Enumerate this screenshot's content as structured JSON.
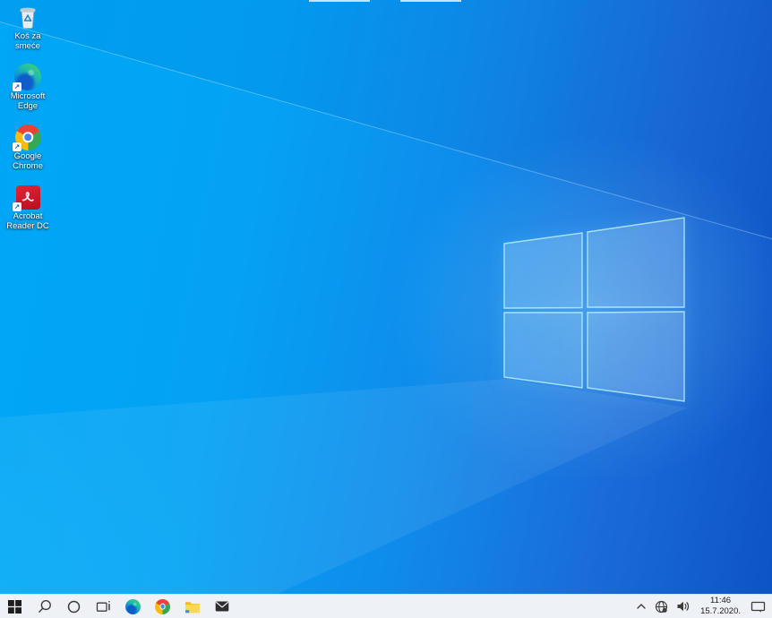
{
  "desktop": {
    "icons": [
      {
        "name": "recycle-bin",
        "label": "Koš za smeće",
        "shortcut": false
      },
      {
        "name": "microsoft-edge",
        "label": "Microsoft Edge",
        "shortcut": true
      },
      {
        "name": "google-chrome",
        "label": "Google Chrome",
        "shortcut": true
      },
      {
        "name": "acrobat-reader",
        "label": "Acrobat Reader DC",
        "shortcut": true
      }
    ],
    "shortcut_arrow": "↗"
  },
  "taskbar": {
    "buttons": [
      {
        "name": "start",
        "icon": "windows-logo-icon"
      },
      {
        "name": "search",
        "icon": "search-icon"
      },
      {
        "name": "cortana",
        "icon": "cortana-circle-icon"
      },
      {
        "name": "task-view",
        "icon": "task-view-icon"
      },
      {
        "name": "microsoft-edge",
        "icon": "edge-icon"
      },
      {
        "name": "google-chrome",
        "icon": "chrome-icon"
      },
      {
        "name": "file-explorer",
        "icon": "folder-icon"
      },
      {
        "name": "mail",
        "icon": "mail-icon"
      }
    ],
    "tray": {
      "hidden_icons": {
        "icon": "chevron-up-icon"
      },
      "network": {
        "icon": "globe-network-icon"
      },
      "volume": {
        "icon": "speaker-icon"
      },
      "clock": {
        "time": "11:46",
        "date": "15.7.2020."
      },
      "action_center": {
        "icon": "action-center-icon"
      }
    }
  },
  "colors": {
    "wallpaper_left": "#00a7f6",
    "wallpaper_right": "#0d53c6",
    "logo_stroke": "#b9f0ff",
    "taskbar_bg": "#eef1f6",
    "chrome_red": "#ea4335",
    "chrome_yellow": "#fbbc05",
    "chrome_green": "#34a853",
    "chrome_blue": "#4285f4"
  }
}
